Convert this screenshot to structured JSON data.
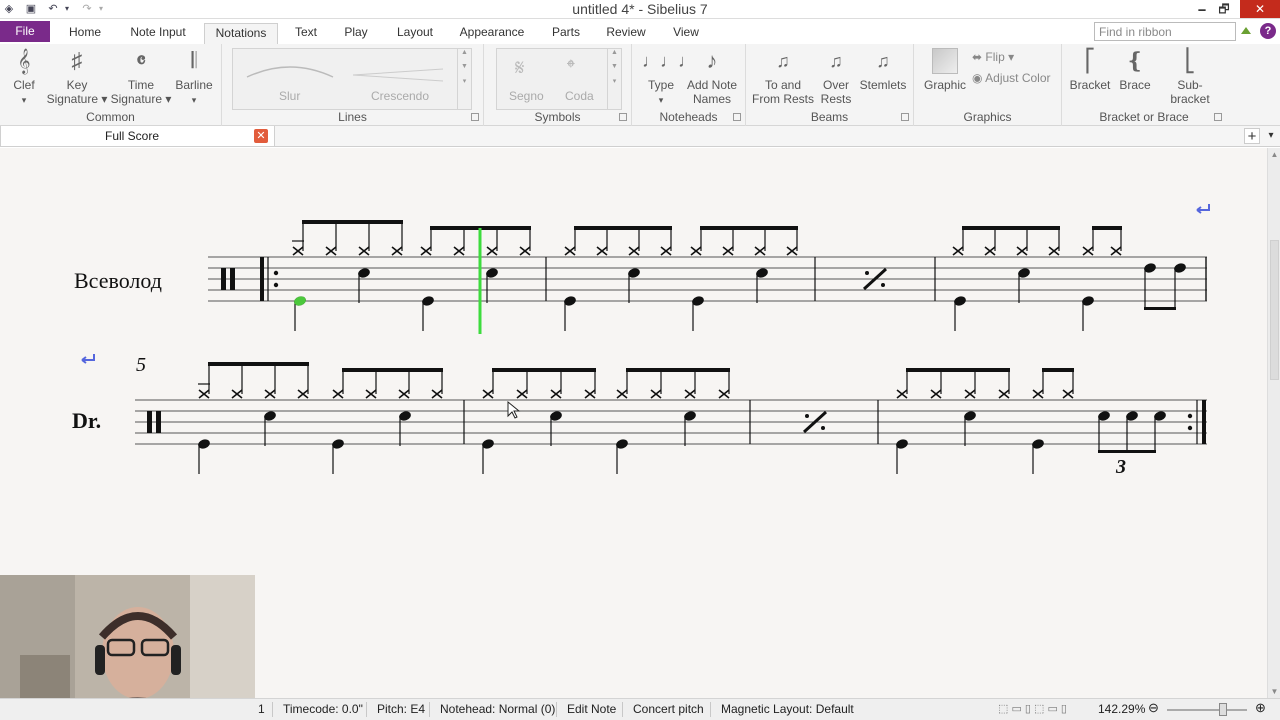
{
  "window": {
    "title": "untitled 4* - Sibelius 7",
    "minimize": "🗕",
    "maximize": "🗗",
    "close": "✕"
  },
  "menu": {
    "file": "File",
    "tabs": [
      {
        "label": "Home"
      },
      {
        "label": "Note Input"
      },
      {
        "label": "Notations"
      },
      {
        "label": "Text"
      },
      {
        "label": "Play"
      },
      {
        "label": "Layout"
      },
      {
        "label": "Appearance"
      },
      {
        "label": "Parts"
      },
      {
        "label": "Review"
      },
      {
        "label": "View"
      }
    ],
    "active_tab": "Notations",
    "find_placeholder": "Find in ribbon"
  },
  "ribbon": {
    "common": {
      "label": "Common",
      "buttons": [
        {
          "label": "Clef",
          "sub": "▾",
          "icon": "clef-icon"
        },
        {
          "label": "Key",
          "sub": "Signature ▾",
          "icon": "key-signature-icon"
        },
        {
          "label": "Time",
          "sub": "Signature ▾",
          "icon": "time-signature-icon"
        },
        {
          "label": "Barline",
          "sub": "▾",
          "icon": "barline-icon"
        }
      ]
    },
    "lines": {
      "label": "Lines",
      "items": [
        "Slur",
        "Crescendo"
      ]
    },
    "symbols": {
      "label": "Symbols",
      "items": [
        "Segno",
        "Coda"
      ]
    },
    "noteheads": {
      "label": "Noteheads",
      "buttons": [
        {
          "label": "Type",
          "sub": "▾"
        },
        {
          "label": "Add Note",
          "sub": "Names"
        }
      ]
    },
    "beams": {
      "label": "Beams",
      "buttons": [
        {
          "label": "To and",
          "sub": "From Rests"
        },
        {
          "label": "Over",
          "sub": "Rests"
        },
        {
          "label": "Stemlets",
          "sub": ""
        }
      ]
    },
    "graphics": {
      "label": "Graphics",
      "graphic": "Graphic",
      "flip": "Flip ▾",
      "adjust_color": "Adjust Color"
    },
    "bracket": {
      "label": "Bracket or Brace",
      "buttons": [
        {
          "label": "Bracket"
        },
        {
          "label": "Brace"
        },
        {
          "label": "Sub-bracket"
        }
      ]
    }
  },
  "doc_tabs": {
    "active": "Full Score",
    "close": "✕",
    "add": "+",
    "menu": "▾"
  },
  "score": {
    "staff1_name": "Всеволод",
    "staff2_name": "Dr.",
    "bar_number": "5",
    "tuplet": "3"
  },
  "status": {
    "page": "1",
    "timecode": "Timecode: 0.0\"",
    "pitch": "Pitch: E4",
    "notehead": "Notehead: Normal (0)",
    "mode": "Edit Note",
    "concert": "Concert pitch",
    "magnetic": "Magnetic Layout: Default",
    "zoom": "142.29%"
  }
}
